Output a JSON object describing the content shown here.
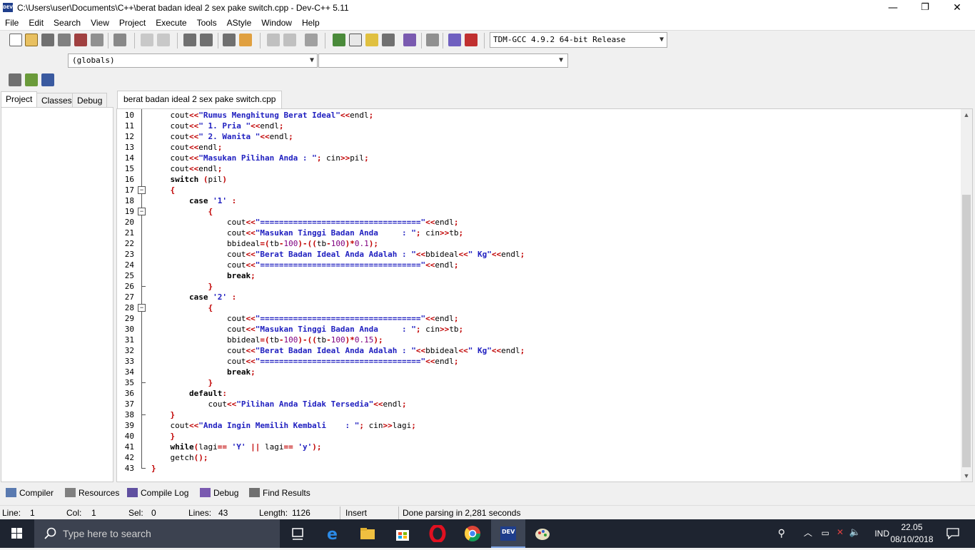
{
  "window": {
    "title": "C:\\Users\\user\\Documents\\C++\\berat badan ideal 2 sex pake switch.cpp - Dev-C++ 5.11",
    "app_icon_text": "DEV",
    "minimize": "—",
    "maximize": "❐",
    "close": "✕"
  },
  "menu": [
    "File",
    "Edit",
    "Search",
    "View",
    "Project",
    "Execute",
    "Tools",
    "AStyle",
    "Window",
    "Help"
  ],
  "toolbar": {
    "compiler": "TDM-GCC 4.9.2 64-bit Release",
    "scope": "(globals)",
    "function": ""
  },
  "left_tabs": [
    "Project",
    "Classes",
    "Debug"
  ],
  "editor_tab": "berat badan ideal 2 sex pake switch.cpp",
  "code_lines": [
    {
      "n": "10",
      "t": "    cout<<\"Rumus Menghitung Berat Ideal\"<<endl;"
    },
    {
      "n": "11",
      "t": "    cout<<\" 1. Pria \"<<endl;"
    },
    {
      "n": "12",
      "t": "    cout<<\" 2. Wanita \"<<endl;"
    },
    {
      "n": "13",
      "t": "    cout<<endl;"
    },
    {
      "n": "14",
      "t": "    cout<<\"Masukan Pilihan Anda : \"; cin>>pil;"
    },
    {
      "n": "15",
      "t": "    cout<<endl;"
    },
    {
      "n": "16",
      "t": "    switch (pil)"
    },
    {
      "n": "17",
      "t": "    {"
    },
    {
      "n": "18",
      "t": "        case '1' :"
    },
    {
      "n": "19",
      "t": "            {"
    },
    {
      "n": "20",
      "t": "                cout<<\"==================================\"<<endl;"
    },
    {
      "n": "21",
      "t": "                cout<<\"Masukan Tinggi Badan Anda     : \"; cin>>tb;"
    },
    {
      "n": "22",
      "t": "                bbideal=(tb-100)-((tb-100)*0.1);"
    },
    {
      "n": "23",
      "t": "                cout<<\"Berat Badan Ideal Anda Adalah : \"<<bbideal<<\" Kg\"<<endl;"
    },
    {
      "n": "24",
      "t": "                cout<<\"==================================\"<<endl;"
    },
    {
      "n": "25",
      "t": "                break;"
    },
    {
      "n": "26",
      "t": "            }"
    },
    {
      "n": "27",
      "t": "        case '2' :"
    },
    {
      "n": "28",
      "t": "            {"
    },
    {
      "n": "29",
      "t": "                cout<<\"==================================\"<<endl;"
    },
    {
      "n": "30",
      "t": "                cout<<\"Masukan Tinggi Badan Anda     : \"; cin>>tb;"
    },
    {
      "n": "31",
      "t": "                bbideal=(tb-100)-((tb-100)*0.15);"
    },
    {
      "n": "32",
      "t": "                cout<<\"Berat Badan Ideal Anda Adalah : \"<<bbideal<<\" Kg\"<<endl;"
    },
    {
      "n": "33",
      "t": "                cout<<\"==================================\"<<endl;"
    },
    {
      "n": "34",
      "t": "                break;"
    },
    {
      "n": "35",
      "t": "            }"
    },
    {
      "n": "36",
      "t": "        default:"
    },
    {
      "n": "37",
      "t": "            cout<<\"Pilihan Anda Tidak Tersedia\"<<endl;"
    },
    {
      "n": "38",
      "t": "    }"
    },
    {
      "n": "39",
      "t": "    cout<<\"Anda Ingin Memilih Kembali    : \"; cin>>lagi;"
    },
    {
      "n": "40",
      "t": "    }"
    },
    {
      "n": "41",
      "t": "    while(lagi== 'Y' || lagi== 'y');"
    },
    {
      "n": "42",
      "t": "    getch();"
    },
    {
      "n": "43",
      "t": "}"
    }
  ],
  "bottom_tabs": [
    "Compiler",
    "Resources",
    "Compile Log",
    "Debug",
    "Find Results"
  ],
  "status": {
    "line_label": "Line:",
    "line_value": "1",
    "col_label": "Col:",
    "col_value": "1",
    "sel_label": "Sel:",
    "sel_value": "0",
    "lines_label": "Lines:",
    "lines_value": "43",
    "length_label": "Length:",
    "length_value": "1126",
    "mode": "Insert",
    "message": "Done parsing in 2,281 seconds"
  },
  "taskbar": {
    "search_placeholder": "Type here to search",
    "language": "IND",
    "time": "22.05",
    "date": "08/10/2018"
  },
  "colors": {
    "string": "#2020c0",
    "punct": "#c00000",
    "taskbar": "#1e2430"
  }
}
